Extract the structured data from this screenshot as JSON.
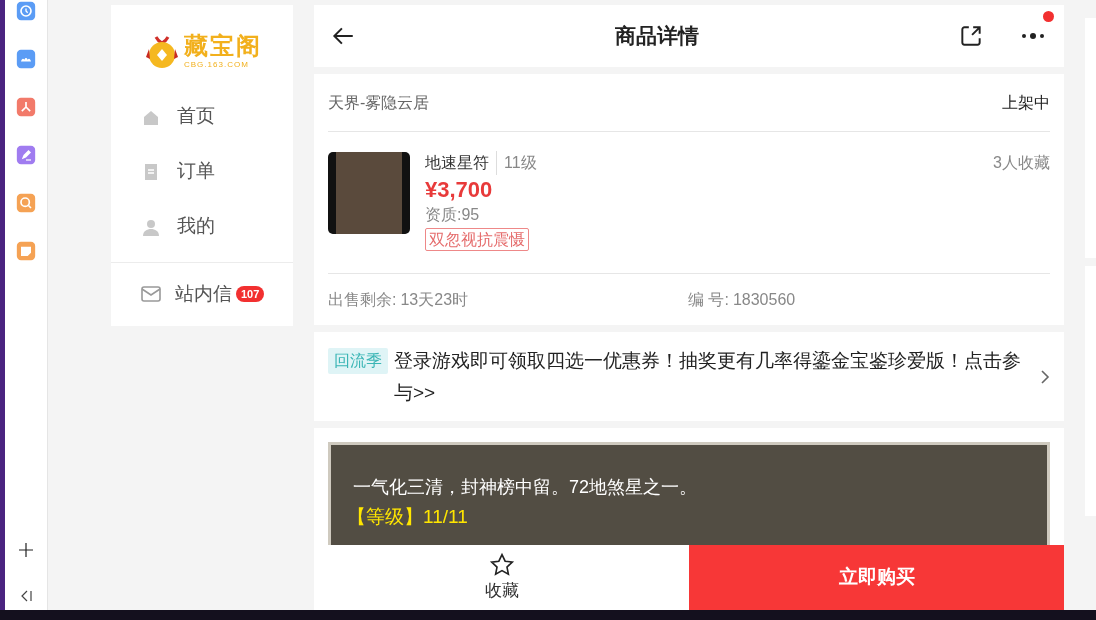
{
  "dock": {
    "apps": [
      {
        "kind": "clock",
        "color": "#5b9cf5"
      },
      {
        "kind": "cloud",
        "color": "#5b9cf5"
      },
      {
        "kind": "pdf",
        "color": "#f27a6a"
      },
      {
        "kind": "pen",
        "color": "#a07cf0"
      },
      {
        "kind": "search",
        "color": "#f5a254"
      },
      {
        "kind": "note",
        "color": "#f5a254"
      }
    ]
  },
  "sidebar": {
    "logo": {
      "name": "藏宝阁",
      "domain": "CBG.163.COM"
    },
    "items": [
      {
        "kind": "home",
        "label": "首页"
      },
      {
        "kind": "order",
        "label": "订单"
      },
      {
        "kind": "user",
        "label": "我的"
      }
    ],
    "inbox": {
      "label": "站内信",
      "badge": "107"
    }
  },
  "header": {
    "title": "商品详情",
    "more_notification": true
  },
  "listing": {
    "server": "天界-雾隐云居",
    "status": "上架中",
    "name": "地速星符",
    "level": "11级",
    "favorites": "3人收藏",
    "price": "¥3,700",
    "quality": "资质:95",
    "tag": "双忽视抗震慑",
    "time_left_label": "出售剩余:",
    "time_left": "13天23时",
    "id_label": "编 号:",
    "id": "1830560"
  },
  "promo": {
    "tag": "回流季",
    "text": "登录游戏即可领取四选一优惠券！抽奖更有几率得鎏金宝鉴珍爱版！点击参与>>"
  },
  "description": {
    "lines": [
      {
        "kind": "plain",
        "text": "一气化三清，封神榜中留。72地煞星之一。"
      },
      {
        "kind": "highlight",
        "text": "【等级】11/11"
      }
    ]
  },
  "bottom_bar": {
    "favorite_label": "收藏",
    "buy_label": "立即购买"
  }
}
